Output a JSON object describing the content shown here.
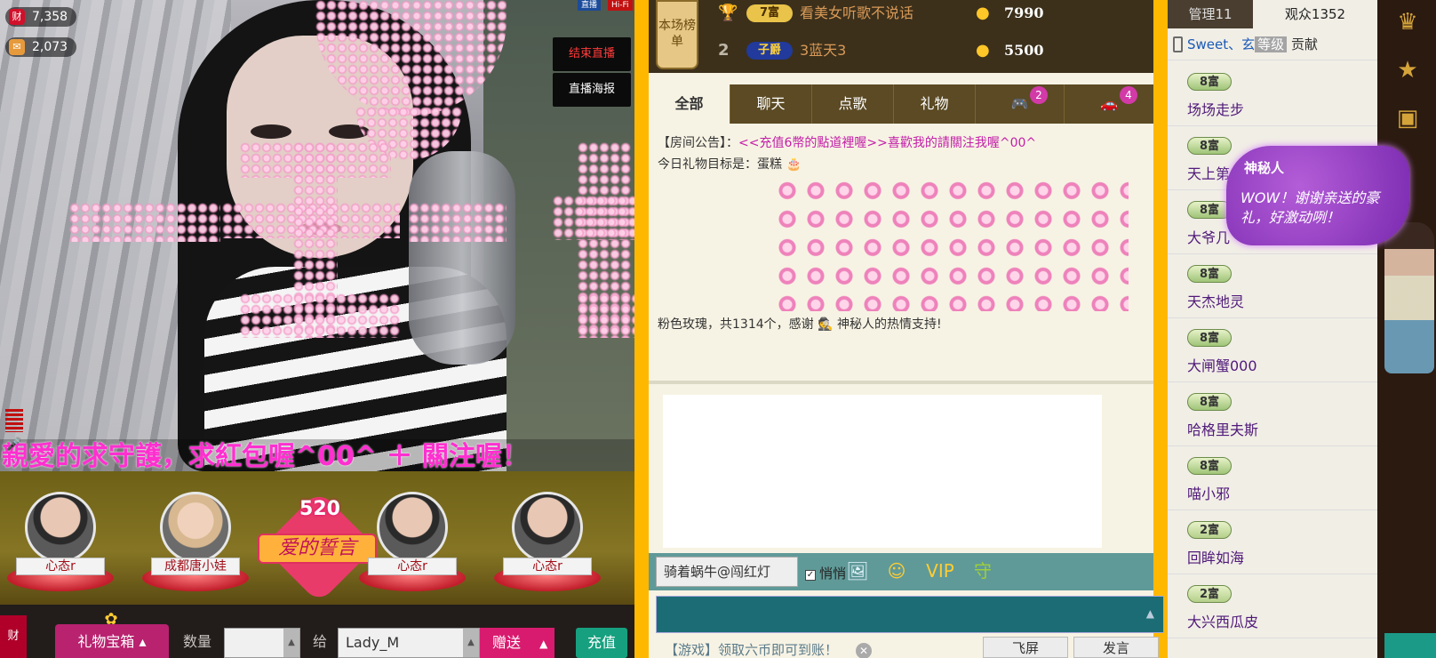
{
  "stats": {
    "wealth": "7,358",
    "gifts": "2,073",
    "wealth_icon": "财"
  },
  "live_labels": [
    "直播",
    "Hi-Fi"
  ],
  "side_buttons": {
    "end_live": "结束直播",
    "poster": "直播海报"
  },
  "ticker": "親愛的求守護，求紅包喔^00^ ＋ 關注喔！",
  "guards": [
    {
      "name": "心态r"
    },
    {
      "name": "成都唐小娃"
    },
    {
      "name": "心态r"
    },
    {
      "name": "心态r"
    }
  ],
  "pledge": {
    "number": "520",
    "label": "爱的誓言"
  },
  "giftbar": {
    "wealth_icon": "财",
    "gift_box": "礼物宝箱",
    "quantity_label": "数量",
    "quantity_value": "",
    "to_label": "给",
    "recipient": "Lady_M",
    "send": "赠送",
    "recharge": "充值"
  },
  "rank": {
    "board_label": "本场榜单",
    "rows": [
      {
        "pos": "",
        "badge": "7富",
        "name": "看美女听歌不说话",
        "score": "7990"
      },
      {
        "pos": "2",
        "badge": "子爵",
        "name": "3蓝天3",
        "score": "5500"
      }
    ]
  },
  "tabs": [
    {
      "label": "全部"
    },
    {
      "label": "聊天"
    },
    {
      "label": "点歌"
    },
    {
      "label": "礼物"
    },
    {
      "label": "",
      "count": "2"
    },
    {
      "label": "",
      "count": "4"
    }
  ],
  "chat": {
    "notice_prefix": "【房间公告】：",
    "notice_link": "<<充值6幣的點道裡喔>>",
    "notice_rest": "喜歡我的請關注我喔^00^",
    "target_text": "今日礼物目标是：蛋糕",
    "thanks_text": "粉色玫瑰，共1314个，感谢",
    "thanks_user": "神秘人",
    "thanks_rest": "的热情支持!"
  },
  "toolbar": {
    "target": "骑着蜗牛@闯红灯",
    "whisper": "悄悄"
  },
  "game": "【游戏】领取六币即可到账！",
  "buttons": {
    "fly": "飞屏",
    "speak": "发言"
  },
  "right": {
    "tab_admin": "管理11",
    "tab_audience": "观众1352",
    "header_user": "Sweet、玄",
    "header_level": "等级",
    "header_contrib": "贡献",
    "users": [
      {
        "badge": "8富",
        "name": "场场走步"
      },
      {
        "badge": "8富",
        "name": "天上第"
      },
      {
        "badge": "8富",
        "name": "大爷几"
      },
      {
        "badge": "8富",
        "name": "天杰地灵"
      },
      {
        "badge": "8富",
        "name": "大闸蟹000"
      },
      {
        "badge": "8富",
        "name": "哈格里夫斯"
      },
      {
        "badge": "8富",
        "name": "喵小邪"
      },
      {
        "badge": "2富",
        "name": "回眸如海"
      },
      {
        "badge": "2富",
        "name": "大兴西瓜皮"
      }
    ]
  },
  "bubble": {
    "who": "神秘人",
    "message": "WOW！谢谢亲送的豪礼，好激动咧！"
  },
  "colors": {
    "accent_gold": "#ffb800",
    "chat_pink": "#c21ea8",
    "send_pink": "#d81b6f",
    "recharge_green": "#17a07f"
  }
}
